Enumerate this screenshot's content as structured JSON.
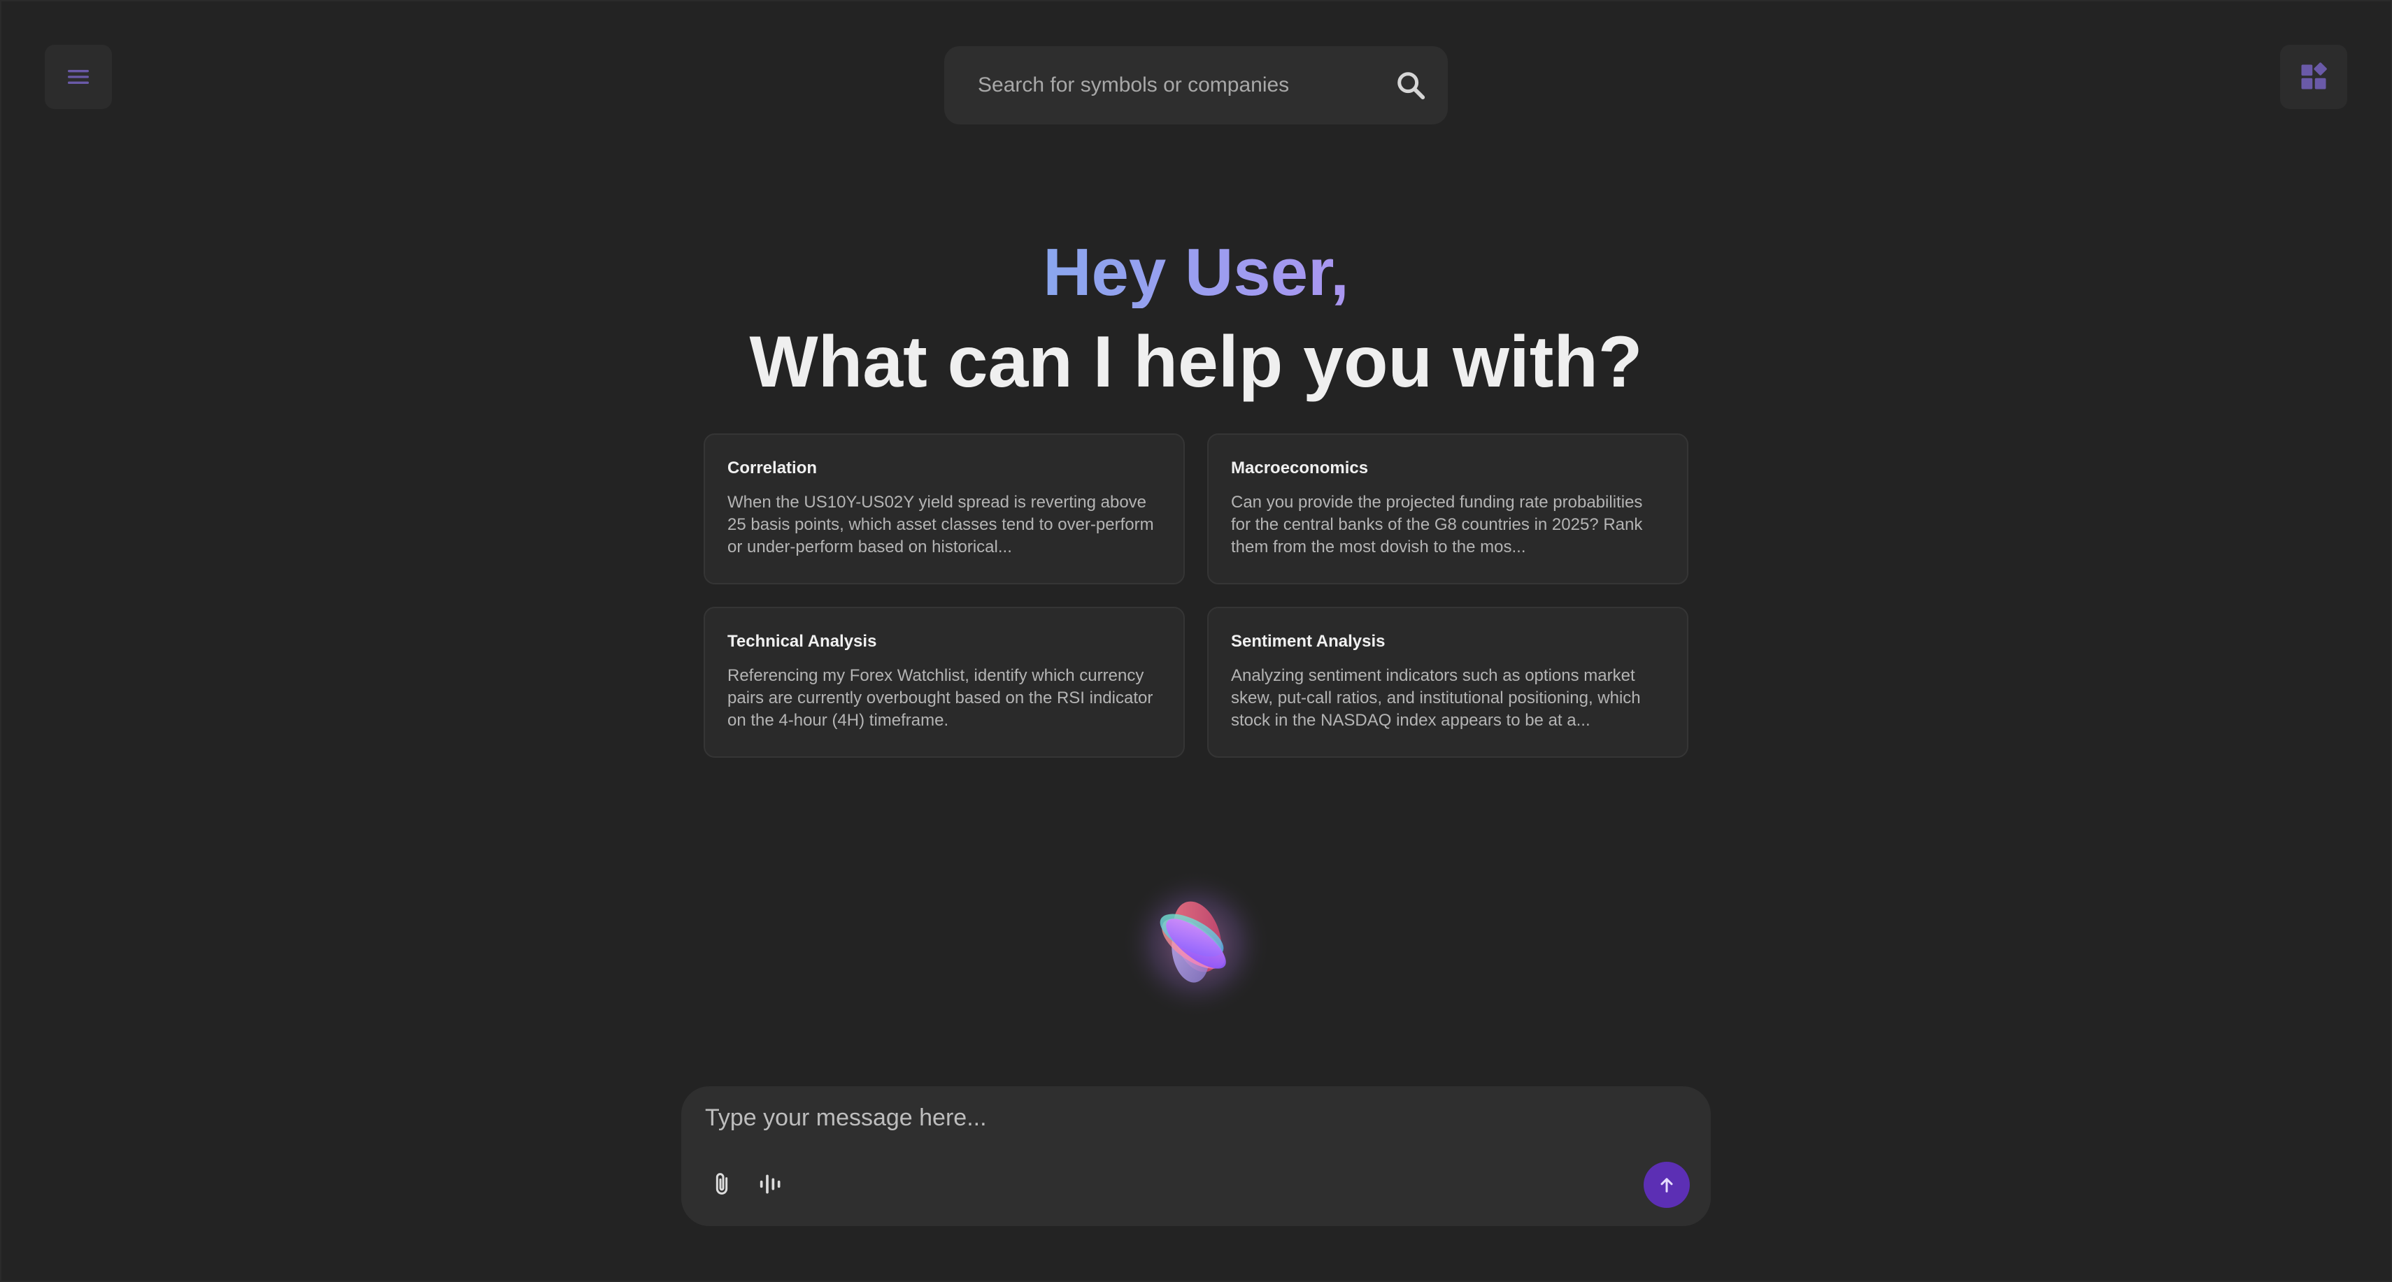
{
  "header": {
    "menu_icon": "hamburger-menu-icon",
    "apps_icon": "widgets-icon",
    "search": {
      "placeholder": "Search for symbols or companies",
      "icon": "search-icon"
    }
  },
  "hero": {
    "greeting": "Hey User,",
    "question": "What can I help you with?"
  },
  "suggestions": [
    {
      "title": "Correlation",
      "text": "When the US10Y-US02Y yield spread is reverting above 25 basis points, which asset classes tend to over-perform or under-perform based on historical..."
    },
    {
      "title": "Macroeconomics",
      "text": "Can you provide the projected funding rate probabilities for the central banks of the G8 countries in 2025? Rank them from the most dovish to the mos..."
    },
    {
      "title": "Technical Analysis",
      "text": "Referencing my Forex Watchlist, identify which currency pairs are currently overbought based on the RSI indicator on the 4-hour (4H) timeframe."
    },
    {
      "title": "Sentiment Analysis",
      "text": "Analyzing sentiment indicators such as options market skew, put-call ratios, and institutional positioning, which stock in the NASDAQ index appears to be at a..."
    }
  ],
  "composer": {
    "placeholder": "Type your message here...",
    "attach_icon": "paperclip-icon",
    "voice_icon": "audio-waveform-icon",
    "send_icon": "arrow-up-icon"
  },
  "colors": {
    "background": "#232323",
    "accent": "#5c2fb4",
    "greeting_gradient_start": "#8aa6ee",
    "greeting_gradient_end": "#aa96f0",
    "icon_purple": "#6a5aa8"
  }
}
